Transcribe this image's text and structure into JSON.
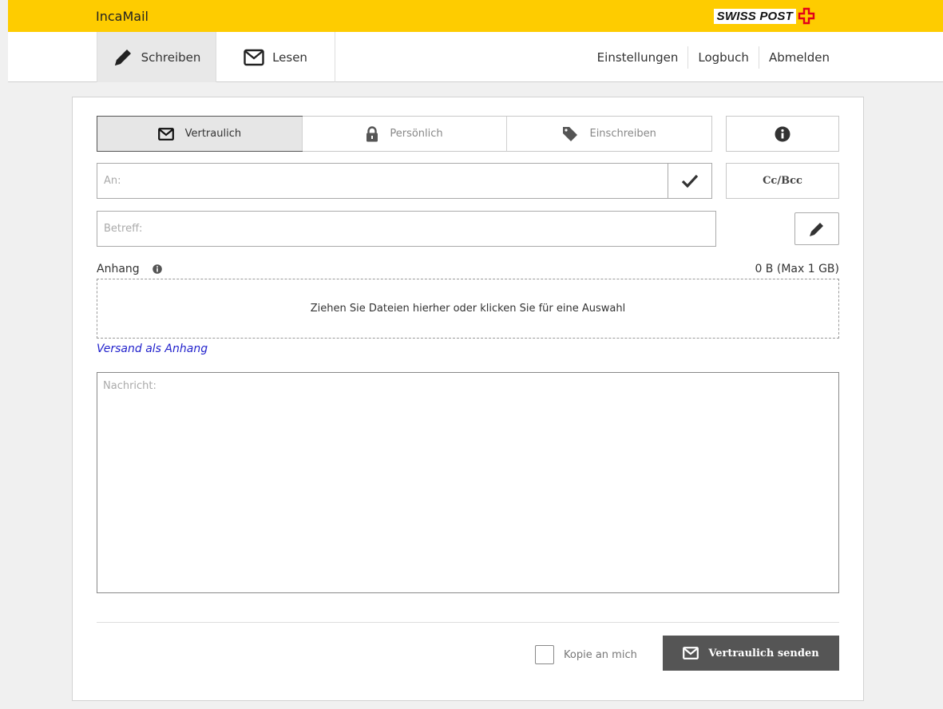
{
  "header": {
    "app_name": "IncaMail",
    "logo_text": "SWISS POST",
    "brand_color": "#fecc00",
    "cross_color": "#e2001a"
  },
  "nav": {
    "tabs": [
      {
        "label": "Schreiben",
        "icon": "pencil-icon",
        "active": true
      },
      {
        "label": "Lesen",
        "icon": "envelope-icon",
        "active": false
      }
    ],
    "links": [
      "Einstellungen",
      "Logbuch",
      "Abmelden"
    ]
  },
  "compose": {
    "modes": [
      {
        "label": "Vertraulich",
        "icon": "envelope-icon",
        "active": true
      },
      {
        "label": "Persönlich",
        "icon": "lock-icon",
        "active": false
      },
      {
        "label": "Einschreiben",
        "icon": "tag-icon",
        "active": false
      }
    ],
    "info_icon": "info-icon",
    "to_placeholder": "An:",
    "check_icon": "checkmark-icon",
    "ccbcc_label": "Cc/Bcc",
    "subject_placeholder": "Betreff:",
    "edit_icon": "pencil-icon",
    "attachment_label": "Anhang",
    "attachment_size": "0 B (Max 1 GB)",
    "dropzone_text": "Ziehen Sie Dateien hierher oder klicken Sie für eine Auswahl",
    "attach_link": "Versand als Anhang",
    "message_placeholder": "Nachricht:",
    "copy_label": "Kopie an mich",
    "copy_checked": false,
    "send_label": "Vertraulich senden",
    "send_color": "#555555"
  }
}
